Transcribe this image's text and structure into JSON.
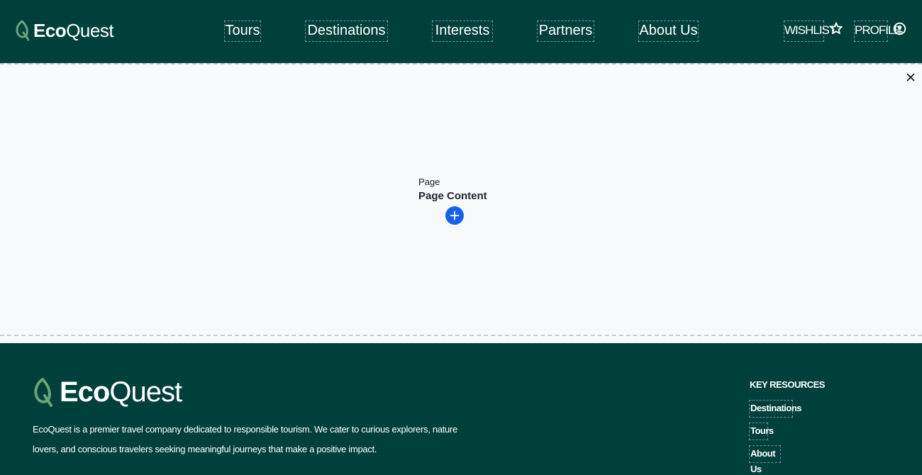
{
  "header": {
    "logo": {
      "eco": "Eco",
      "quest": "Quest"
    },
    "nav": [
      {
        "label": "Tours"
      },
      {
        "label": "Destinations"
      },
      {
        "label": "Interests"
      },
      {
        "label": "Partners"
      },
      {
        "label": "About Us"
      }
    ],
    "wishlist_label": "WISHLIST",
    "profile_label": "PROFILE"
  },
  "main": {
    "page_label": "Page",
    "page_title": "Page Content"
  },
  "footer": {
    "logo": {
      "eco": "Eco",
      "quest": "Quest"
    },
    "description": "EcoQuest is a premier travel company dedicated to responsible tourism. We cater to curious explorers, nature lovers, and conscious travelers seeking meaningful journeys that make a positive impact.",
    "resources_title": "KEY RESOURCES",
    "links": [
      {
        "label": "Destinations"
      },
      {
        "label": "Tours"
      },
      {
        "label": "About Us"
      }
    ]
  },
  "colors": {
    "brand_dark_green": "#00403a",
    "leaf_green": "#6aa37a",
    "add_button_blue": "#1660e8",
    "page_background": "#f8f9fb"
  }
}
